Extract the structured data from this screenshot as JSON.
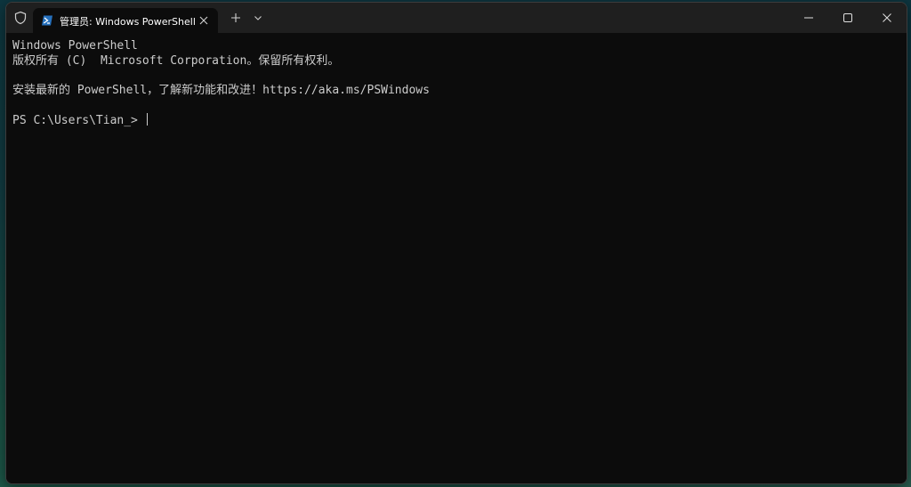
{
  "window": {
    "tab_title": "管理员: Windows PowerShell",
    "icons": {
      "shield": "shield-icon",
      "tab": "powershell-icon",
      "tab_close": "close-icon",
      "new_tab": "plus-icon",
      "dropdown": "chevron-down-icon",
      "minimize": "minimize-icon",
      "maximize": "maximize-icon",
      "close": "close-icon"
    }
  },
  "terminal": {
    "lines": [
      "Windows PowerShell",
      "版权所有 (C)  Microsoft Corporation。保留所有权利。",
      "",
      "安装最新的 PowerShell，了解新功能和改进！https://aka.ms/PSWindows",
      ""
    ],
    "prompt": "PS C:\\Users\\Tian_> "
  },
  "colors": {
    "titlebar": "#1f1f1f",
    "background": "#0c0c0c",
    "text": "#cccccc",
    "powershell_blue": "#2671be"
  }
}
